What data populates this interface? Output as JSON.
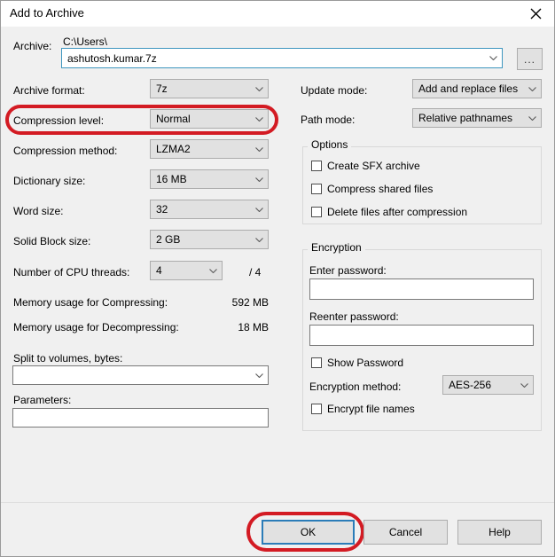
{
  "window": {
    "title": "Add to Archive",
    "close_icon": "close-icon"
  },
  "archive": {
    "label": "Archive:",
    "path_text": "C:\\Users\\",
    "filename_value": "ashutosh.kumar.7z",
    "browse_label": "...",
    "dropdown_icon": "chevron-down-icon"
  },
  "left_column": {
    "archive_format": {
      "label": "Archive format:",
      "value": "7z"
    },
    "compression_level": {
      "label": "Compression level:",
      "value": "Normal"
    },
    "compression_method": {
      "label": "Compression method:",
      "value": "LZMA2"
    },
    "dictionary_size": {
      "label": "Dictionary size:",
      "value": "16 MB"
    },
    "word_size": {
      "label": "Word size:",
      "value": "32"
    },
    "solid_block_size": {
      "label": "Solid Block size:",
      "value": "2 GB"
    },
    "cpu_threads": {
      "label": "Number of CPU threads:",
      "value": "4",
      "total": "/ 4"
    },
    "memory_compress": {
      "label": "Memory usage for Compressing:",
      "value": "592 MB"
    },
    "memory_decompress": {
      "label": "Memory usage for Decompressing:",
      "value": "18 MB"
    },
    "split_volumes": {
      "label": "Split to volumes, bytes:",
      "value": ""
    },
    "parameters": {
      "label": "Parameters:",
      "value": ""
    }
  },
  "right_column": {
    "update_mode": {
      "label": "Update mode:",
      "value": "Add and replace files"
    },
    "path_mode": {
      "label": "Path mode:",
      "value": "Relative pathnames"
    },
    "options": {
      "title": "Options",
      "items": [
        {
          "label": "Create SFX archive",
          "checked": false
        },
        {
          "label": "Compress shared files",
          "checked": false
        },
        {
          "label": "Delete files after compression",
          "checked": false
        }
      ]
    },
    "encryption": {
      "title": "Encryption",
      "enter_password": {
        "label": "Enter password:",
        "value": ""
      },
      "reenter_password": {
        "label": "Reenter password:",
        "value": ""
      },
      "show_password": {
        "label": "Show Password",
        "checked": false
      },
      "encryption_method": {
        "label": "Encryption method:",
        "value": "AES-256"
      },
      "encrypt_file_names": {
        "label": "Encrypt file names",
        "checked": false
      }
    }
  },
  "footer": {
    "ok": "OK",
    "cancel": "Cancel",
    "help": "Help"
  },
  "annotations": {
    "accent_color": "#d31b23",
    "highlight_compression_level": "compression-level-row",
    "highlight_ok": "ok-button"
  }
}
